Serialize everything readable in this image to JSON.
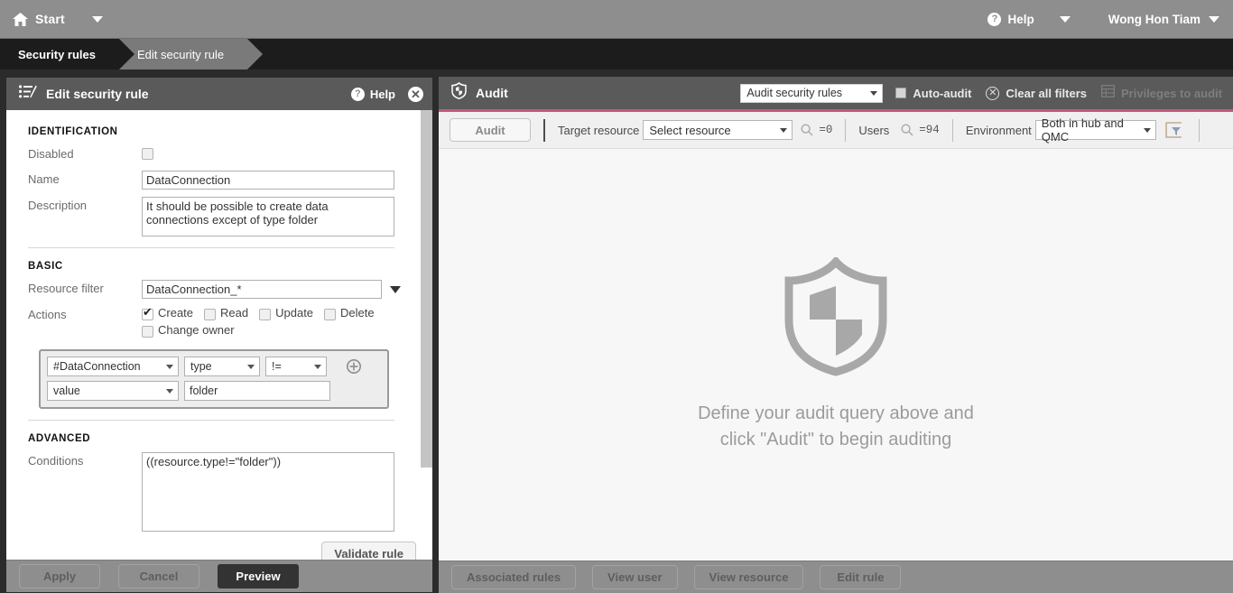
{
  "topbar": {
    "home_icon": "home-icon",
    "start_label": "Start",
    "start_caret": "chevron-down-icon",
    "help_label": "Help",
    "help_icon": "question-circle-icon",
    "help_caret": "chevron-down-icon",
    "user_label": "Wong Hon Tiam",
    "user_caret": "chevron-down-icon"
  },
  "breadcrumb": {
    "items": [
      {
        "label": "Security rules",
        "active": false
      },
      {
        "label": "Edit security rule",
        "active": true
      }
    ]
  },
  "left_panel": {
    "header": {
      "icon": "edit-list-icon",
      "title": "Edit security rule",
      "help_label": "Help",
      "help_icon": "question-circle-icon",
      "close_icon": "close-icon"
    },
    "identification": {
      "section_title": "IDENTIFICATION",
      "disabled_label": "Disabled",
      "disabled_checked": false,
      "name_label": "Name",
      "name_value": "DataConnection",
      "description_label": "Description",
      "description_value": "It should be possible to create data connections except of type folder"
    },
    "basic": {
      "section_title": "BASIC",
      "resource_filter_label": "Resource filter",
      "resource_filter_value": "DataConnection_*",
      "actions_label": "Actions",
      "actions": [
        {
          "label": "Create",
          "checked": true
        },
        {
          "label": "Read",
          "checked": false
        },
        {
          "label": "Update",
          "checked": false
        },
        {
          "label": "Delete",
          "checked": false
        },
        {
          "label": "Change owner",
          "checked": false
        }
      ],
      "condition_builder": {
        "resource_select": "#DataConnection",
        "property_select": "type",
        "operator_select": "!=",
        "valuetype_select": "value",
        "value_input": "folder",
        "add_icon": "plus-circle-icon"
      }
    },
    "advanced": {
      "section_title": "ADVANCED",
      "conditions_label": "Conditions",
      "conditions_value": "((resource.type!=\"folder\"))",
      "validate_label": "Validate rule"
    },
    "footer": {
      "apply_label": "Apply",
      "cancel_label": "Cancel",
      "preview_label": "Preview"
    }
  },
  "right_panel": {
    "header": {
      "icon": "shield-icon",
      "title": "Audit",
      "mode_select": "Audit security rules",
      "auto_audit_label": "Auto-audit",
      "auto_audit_checked": false,
      "clear_filters_label": "Clear all filters",
      "clear_filters_icon": "x-circle-icon",
      "privileges_label": "Privileges to audit",
      "privileges_icon": "table-icon"
    },
    "query_bar": {
      "audit_button": "Audit",
      "target_resource_label": "Target resource",
      "target_resource_value": "Select resource",
      "target_resource_count": "=0",
      "users_label": "Users",
      "users_count": "=94",
      "environment_label": "Environment",
      "environment_value": "Both in hub and QMC",
      "search_icon": "search-icon",
      "filter_icon": "filter-box-icon"
    },
    "empty_state": {
      "icon": "shield-large-icon",
      "line1": "Define your audit query above and",
      "line2": "click \"Audit\" to begin auditing"
    },
    "footer": {
      "buttons": [
        "Associated rules",
        "View user",
        "View resource",
        "Edit rule"
      ]
    }
  },
  "colors": {
    "accent_pink": "#c4587e",
    "topbar_gray": "#8e8e8e",
    "panel_head_gray": "#5a5a5a",
    "crumb_dark": "#1c1c1c"
  }
}
